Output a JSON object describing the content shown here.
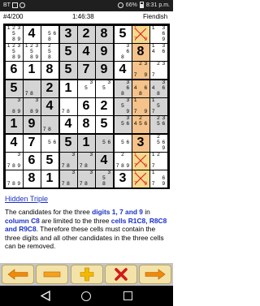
{
  "status_bar": {
    "carrier": "BT",
    "battery": "66%",
    "time": "8:31 p.m."
  },
  "header": {
    "puzzle_no": "#4/200",
    "timer": "1:46:38",
    "difficulty": "Fiendish"
  },
  "colors": {
    "cell_white": "#ffffff",
    "cell_grey": "#d4d4d4",
    "cell_yellow": "#f5d98c",
    "cell_orange": "#f4c28a",
    "cand_red": "#e0191d",
    "cand_blue": "#1a2fc7",
    "toolbar_bg": "#c4c4c4",
    "button_bg": "#f3e3a8",
    "arrow": "#f08a0c",
    "plus": "#f5b800",
    "minus": "#f5a020",
    "cross": "#d21a1a"
  },
  "cells": [
    [
      "c:1|2|3|5|8|9",
      "4",
      "c:5|6|8",
      "3",
      "2",
      "8",
      "5",
      "c:1|7|9",
      "c:1|3|6|9"
    ],
    [
      "c:1|2|3|5|8|9",
      "c:1|2|3|5|8|9",
      "c:2|5|8",
      "5",
      "4",
      "9",
      "c:3|6|8",
      "8",
      "c:1|3|4|6"
    ],
    [
      "6",
      "1",
      "8",
      "5",
      "7",
      "9",
      "4",
      "c:2|3|7|9",
      "c:2|3|7"
    ],
    [
      "5",
      "c:7|8",
      "2",
      "1",
      "c:3|5",
      "c:3|5",
      "c:3|6|8",
      "c:4|6|8",
      "c:3|4|6|8"
    ],
    [
      "c:3|8|9",
      "c:3|8|9",
      "4",
      "c:7|8",
      "6",
      "2",
      "c:3|5|9",
      "c:1|7|9",
      "c:1|5|7"
    ],
    [
      "1",
      "9",
      "c:7|8",
      "4",
      "8",
      "5",
      "c:3|5|6",
      "c:2|4|5|6",
      "c:2|3|5|6"
    ],
    [
      "4",
      "7",
      "c:5|6",
      "5",
      "1",
      "c:5|6",
      "c:5|6",
      "3",
      "c:2|5|6|9"
    ],
    [
      "c:3|7|8|9",
      "6",
      "5",
      "c:3|7|8",
      "c:3|7|8",
      "4",
      "c:2|7|8|9",
      "c:1|7|9",
      "c:1|2|7"
    ],
    [
      "c:7|8|9",
      "8",
      "1",
      "c:3|7|8",
      "c:3|7|8",
      "c:3|5|8",
      "3",
      "c:1|7|9",
      "c:1|6|7|9"
    ]
  ],
  "hint": {
    "title": "Hidden Triple",
    "t1": "The candidates for the three ",
    "b1": "digits 1, 7 and 9",
    "t2": " in ",
    "b2": "column C8",
    "t3": " are limited to the three ",
    "b3": "cells R1C8, R8C8 and R9C8",
    "t4": ". Therefore these cells must contain the three digits and all other candidates in the three cells can be removed."
  },
  "toolbar": {
    "back_icon": "arrow-left-icon",
    "minus_icon": "minus-icon",
    "plus_icon": "plus-icon",
    "close_icon": "close-icon",
    "forward_icon": "arrow-right-icon"
  }
}
